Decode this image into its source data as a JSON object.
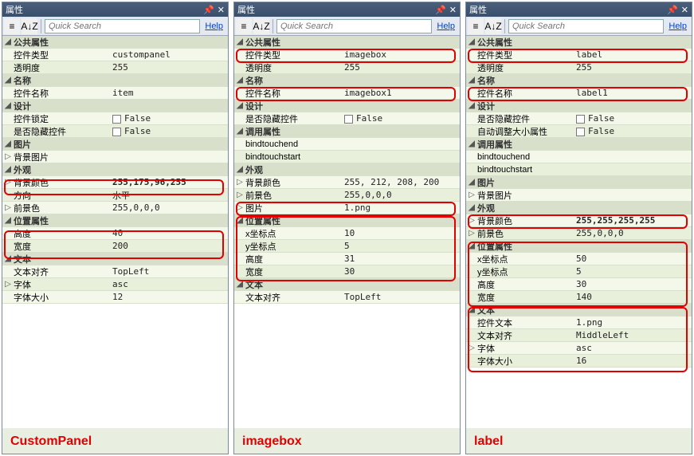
{
  "window": {
    "title": "属性"
  },
  "toolbar": {
    "cat_icon": "≡",
    "sort_icon": "A↓Z",
    "search_placeholder": "Quick Search",
    "help_label": "Help"
  },
  "headers": {
    "public_props": "公共属性",
    "name": "名称",
    "design": "设计",
    "call_props": "调用属性",
    "picture": "图片",
    "appearance": "外观",
    "position": "位置属性",
    "text": "文本"
  },
  "labels": {
    "ctrl_type": "控件类型",
    "opacity": "透明度",
    "ctrl_name": "控件名称",
    "ctrl_lock": "控件锁定",
    "hidden": "是否隐藏控件",
    "autosize": "自动调整大小属性",
    "bindtouchend": "bindtouchend",
    "bindtouchstart": "bindtouchstart",
    "bg_image": "背景图片",
    "bg_color": "背景颜色",
    "direction": "方向",
    "fg_color": "前景色",
    "image": "图片",
    "x": "x坐标点",
    "y": "y坐标点",
    "height": "高度",
    "width": "宽度",
    "ctrl_text": "控件文本",
    "text_align": "文本对齐",
    "font": "字体",
    "font_size": "字体大小"
  },
  "values": {
    "false": "False",
    "horizontal": "水平"
  },
  "panels": [
    {
      "caption": "CustomPanel",
      "data": {
        "ctrl_type": "custompanel",
        "opacity": "255",
        "ctrl_name": "item",
        "ctrl_lock": "False",
        "hidden": "False",
        "bg_color": "255,175,96,255",
        "direction": "水平",
        "fg_color": "255,0,0,0",
        "height": "40",
        "width": "200",
        "text_align": "TopLeft",
        "font": "asc",
        "font_size": "12"
      }
    },
    {
      "caption": "imagebox",
      "data": {
        "ctrl_type": "imagebox",
        "opacity": "255",
        "ctrl_name": "imagebox1",
        "hidden": "False",
        "bg_color": "255, 212, 208, 200",
        "fg_color": "255,0,0,0",
        "image": "1.png",
        "x": "10",
        "y": "5",
        "height": "31",
        "width": "30",
        "text_align": "TopLeft"
      }
    },
    {
      "caption": "label",
      "data": {
        "ctrl_type": "label",
        "opacity": "255",
        "ctrl_name": "label1",
        "hidden": "False",
        "autosize": "False",
        "bg_color": "255,255,255,255",
        "fg_color": "255,0,0,0",
        "x": "50",
        "y": "5",
        "height": "30",
        "width": "140",
        "ctrl_text": "1.png",
        "text_align": "MiddleLeft",
        "font": "asc",
        "font_size": "16"
      }
    }
  ]
}
